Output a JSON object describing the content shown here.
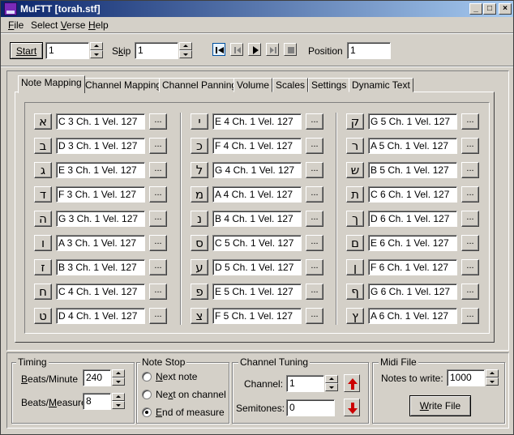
{
  "window": {
    "title": "MuFTT [torah.stf]",
    "controls": {
      "minimize": "_",
      "maximize": "□",
      "close": "×"
    }
  },
  "menu": {
    "file": {
      "pre": "",
      "key": "F",
      "post": "ile"
    },
    "select_verse": {
      "pre": "Select ",
      "key": "V",
      "post": "erse"
    },
    "help": {
      "pre": "",
      "key": "H",
      "post": "elp"
    }
  },
  "toolbar": {
    "start_label": "Start",
    "start_value": "1",
    "skip_label_pre": "S",
    "skip_label_key": "k",
    "skip_label_post": "ip",
    "skip_value": "1",
    "position_label": "Position",
    "position_value": "1",
    "media": {
      "active": "play"
    }
  },
  "tabs": [
    {
      "label": "Note Mapping"
    },
    {
      "label": "Channel Mapping"
    },
    {
      "label": "Channel Panning"
    },
    {
      "label": "Volume"
    },
    {
      "label": "Scales"
    },
    {
      "label": "Settings"
    },
    {
      "label": "Dynamic Text"
    }
  ],
  "selected_tab": 0,
  "note_mapping": {
    "columns": [
      [
        {
          "letter": "א",
          "value": "C 3 Ch. 1 Vel. 127"
        },
        {
          "letter": "ב",
          "value": "D 3 Ch. 1 Vel. 127"
        },
        {
          "letter": "ג",
          "value": "E 3 Ch. 1 Vel. 127"
        },
        {
          "letter": "ד",
          "value": "F 3 Ch. 1 Vel. 127"
        },
        {
          "letter": "ה",
          "value": "G 3 Ch. 1 Vel. 127"
        },
        {
          "letter": "ו",
          "value": "A 3 Ch. 1 Vel. 127"
        },
        {
          "letter": "ז",
          "value": "B 3 Ch. 1 Vel. 127"
        },
        {
          "letter": "ח",
          "value": "C 4 Ch. 1 Vel. 127"
        },
        {
          "letter": "ט",
          "value": "D 4 Ch. 1 Vel. 127"
        }
      ],
      [
        {
          "letter": "י",
          "value": "E 4 Ch. 1 Vel. 127"
        },
        {
          "letter": "כ",
          "value": "F 4 Ch. 1 Vel. 127"
        },
        {
          "letter": "ל",
          "value": "G 4 Ch. 1 Vel. 127"
        },
        {
          "letter": "מ",
          "value": "A 4 Ch. 1 Vel. 127"
        },
        {
          "letter": "נ",
          "value": "B 4 Ch. 1 Vel. 127"
        },
        {
          "letter": "ס",
          "value": "C 5 Ch. 1 Vel. 127"
        },
        {
          "letter": "ע",
          "value": "D 5 Ch. 1 Vel. 127"
        },
        {
          "letter": "פ",
          "value": "E 5 Ch. 1 Vel. 127"
        },
        {
          "letter": "צ",
          "value": "F 5 Ch. 1 Vel. 127"
        }
      ],
      [
        {
          "letter": "ק",
          "value": "G 5 Ch. 1 Vel. 127"
        },
        {
          "letter": "ר",
          "value": "A 5 Ch. 1 Vel. 127"
        },
        {
          "letter": "ש",
          "value": "B 5 Ch. 1 Vel. 127"
        },
        {
          "letter": "ת",
          "value": "C 6 Ch. 1 Vel. 127"
        },
        {
          "letter": "ך",
          "value": "D 6 Ch. 1 Vel. 127"
        },
        {
          "letter": "ם",
          "value": "E 6 Ch. 1 Vel. 127"
        },
        {
          "letter": "ן",
          "value": "F 6 Ch. 1 Vel. 127"
        },
        {
          "letter": "ף",
          "value": "G 6 Ch. 1 Vel. 127"
        },
        {
          "letter": "ץ",
          "value": "A 6 Ch. 1 Vel. 127"
        }
      ]
    ],
    "dots_label": "..."
  },
  "timing": {
    "title": "Timing",
    "bpm_label_pre": "",
    "bpm_label_key": "B",
    "bpm_label_post": "eats/Minute",
    "bpm_value": "240",
    "bpmeas_label_pre": "Beats/",
    "bpmeas_label_key": "M",
    "bpmeas_label_post": "easure",
    "bpmeas_value": "8"
  },
  "note_stop": {
    "title": "Note Stop",
    "options": [
      {
        "pre": "",
        "key": "N",
        "post": "ext note",
        "checked": false
      },
      {
        "pre": "Ne",
        "key": "x",
        "post": "t on channel",
        "checked": false
      },
      {
        "pre": "",
        "key": "E",
        "post": "nd of measure",
        "checked": true
      }
    ]
  },
  "channel_tuning": {
    "title": "Channel Tuning",
    "channel_label": "Channel:",
    "channel_value": "1",
    "semitones_label": "Semitones:",
    "semitones_value": "0",
    "up_color": "#cc0000",
    "down_color": "#cc0000"
  },
  "midi_file": {
    "title": "Midi File",
    "notes_label": "Notes to write:",
    "notes_value": "1000",
    "write_pre": "",
    "write_key": "W",
    "write_post": "rite File"
  }
}
